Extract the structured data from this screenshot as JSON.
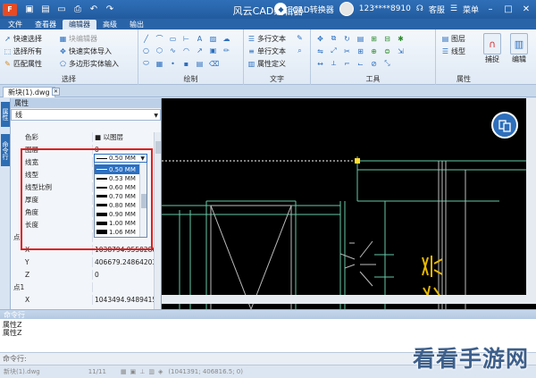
{
  "titlebar": {
    "logo": "F",
    "title": "风云CAD编辑器",
    "converter": "CAD转换器",
    "account": "123****8910",
    "service": "客服",
    "menu": "菜单",
    "quick_icons": [
      "save-icon",
      "open-icon",
      "new-icon",
      "print-icon",
      "undo-icon",
      "redo-icon"
    ]
  },
  "ribbon_tabs": [
    "文件",
    "查看器",
    "编辑器",
    "高级",
    "输出"
  ],
  "ribbon": {
    "select": {
      "label": "选择",
      "items": [
        "快速选择",
        "选择所有",
        "匹配属性",
        "块编辑器",
        "快速实体导入",
        "多边形实体输入"
      ]
    },
    "draw": {
      "label": "绘制"
    },
    "text": {
      "label": "文字",
      "items": [
        "多行文本",
        "单行文本",
        "属性定义"
      ]
    },
    "tools": {
      "label": "工具"
    },
    "props": {
      "label": "属性",
      "items": [
        "图层",
        "线型"
      ],
      "capture": "捕捉",
      "edit": "编辑"
    }
  },
  "document_tab": "新块(1).dwg",
  "left_tabs": [
    "属性",
    "命令行"
  ],
  "properties": {
    "header": "属性",
    "selector": "线",
    "rows": [
      {
        "name": "色彩",
        "value": "■ 以图层"
      },
      {
        "name": "图层",
        "value": "0"
      },
      {
        "name": "线宽",
        "value": ""
      },
      {
        "name": "线型",
        "value": ""
      },
      {
        "name": "线型比例",
        "value": ""
      },
      {
        "name": "厚度",
        "value": ""
      },
      {
        "name": "角度",
        "value": ""
      },
      {
        "name": "长度",
        "value": ""
      },
      {
        "name": "点",
        "value": "",
        "group": true
      },
      {
        "name": "X",
        "value": "1038794.95502860"
      },
      {
        "name": "Y",
        "value": "406679.24864203"
      },
      {
        "name": "Z",
        "value": "0"
      },
      {
        "name": "点1",
        "value": "",
        "group": true
      },
      {
        "name": "X",
        "value": "1043494.9489415"
      }
    ],
    "lineweight_current": "0.50 MM",
    "lineweight_options": [
      "0.50 MM",
      "0.53 MM",
      "0.60 MM",
      "0.70 MM",
      "0.80 MM",
      "0.90 MM",
      "1.00 MM",
      "1.06 MM"
    ]
  },
  "command": {
    "title": "命令行",
    "output": [
      "属性Z",
      "属性Z"
    ],
    "prompt": "命令行:"
  },
  "status": {
    "file": "新块(1).dwg",
    "pages": "11/11",
    "coords": "(1041391; 406816.5; 0)"
  },
  "watermark": "看看手游网"
}
